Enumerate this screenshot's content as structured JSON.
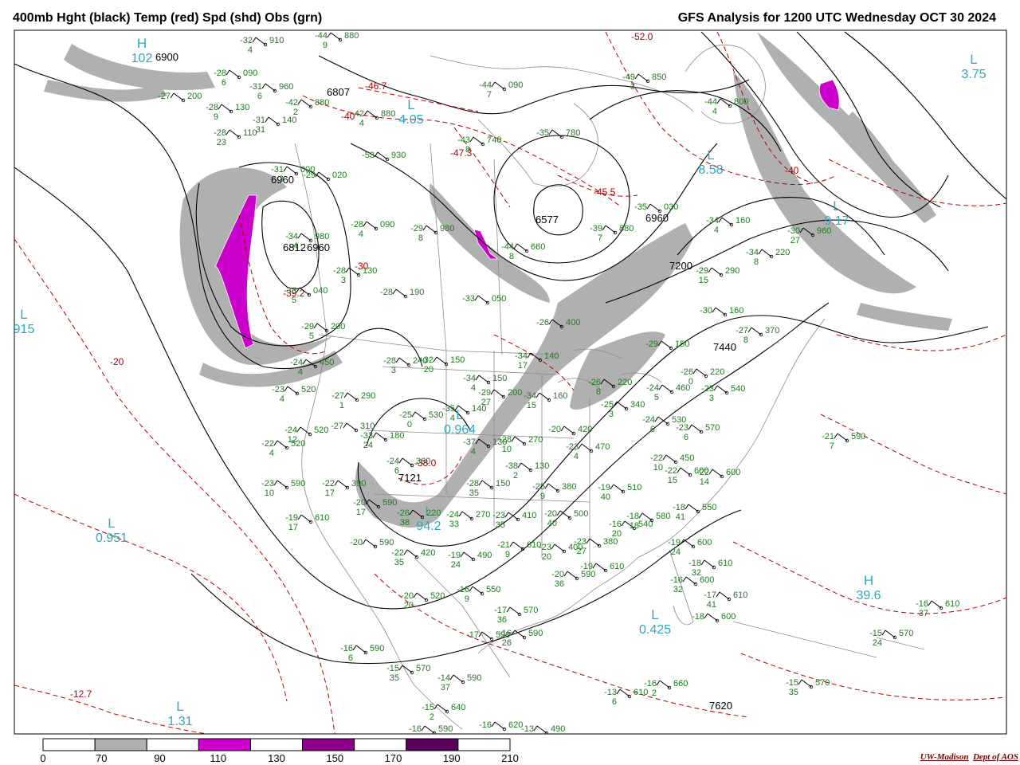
{
  "header": {
    "left_title": "400mb Hght (black) Temp (red) Spd (shd) Obs (grn)",
    "right_title": "GFS Analysis for 1200 UTC Wednesday  OCT 30 2024"
  },
  "colors": {
    "height_contour": "#000000",
    "temp_contour": "#b30000",
    "speed_70_90": "#b0b0b0",
    "speed_110_130": "#cc00cc",
    "speed_150_170": "#8c008c",
    "speed_190_210": "#5a005a",
    "obs": "#1f7a1f",
    "pressure_center": "#2aa9c0",
    "geography": "#8a8a8a"
  },
  "legend": {
    "labels": [
      "0",
      "70",
      "90",
      "110",
      "130",
      "150",
      "170",
      "190",
      "210"
    ]
  },
  "credit": {
    "org": "UW-Madison",
    "dept": "Dept of AOS"
  },
  "centers": [
    {
      "letter": "L",
      "value": "3.75"
    },
    {
      "letter": "L",
      "value": "8.58"
    },
    {
      "letter": "L",
      "value": "9.17"
    },
    {
      "letter": "L",
      "value": "0.964"
    },
    {
      "letter": "L",
      "value": "0.951"
    },
    {
      "letter": "L",
      "value": "0.425"
    },
    {
      "letter": "L",
      "value": "4.05"
    },
    {
      "letter": "L",
      "value": "1.31"
    },
    {
      "letter": "L",
      "value": "915"
    },
    {
      "letter": "L",
      "value": "94.2"
    },
    {
      "letter": "H",
      "value": "39.6"
    },
    {
      "letter": "H",
      "value": "102"
    }
  ],
  "height_labels": [
    "6807",
    "6960",
    "6812",
    "6960",
    "6577",
    "6960",
    "7121",
    "7440",
    "7620",
    "7200",
    "6900"
  ],
  "temp_labels": [
    "-46.7",
    "-40",
    "-47.3",
    "-45.5",
    "-52.0",
    "-40",
    "-30",
    "-39.2",
    "-20",
    "-12.7",
    "-38.0"
  ],
  "observations": [
    {
      "t": "-32",
      "h": "910",
      "d": "4"
    },
    {
      "t": "-44",
      "h": "880",
      "d": "9"
    },
    {
      "t": "-28",
      "h": "090",
      "d": "6"
    },
    {
      "t": "-27",
      "h": "200",
      "d": ""
    },
    {
      "t": "-31",
      "h": "960",
      "d": "6"
    },
    {
      "t": "-42",
      "h": "880",
      "d": "2"
    },
    {
      "t": "-28",
      "h": "130",
      "d": "9"
    },
    {
      "t": "-31",
      "h": "140",
      "d": "31"
    },
    {
      "t": "-28",
      "h": "110",
      "d": "23"
    },
    {
      "t": "-44",
      "h": "090",
      "d": "7"
    },
    {
      "t": "-42",
      "h": "880",
      "d": "4"
    },
    {
      "t": "-43",
      "h": "740",
      "d": "8"
    },
    {
      "t": "-53",
      "h": "930",
      "d": ""
    },
    {
      "t": "-35",
      "h": "780",
      "d": ""
    },
    {
      "t": "-49",
      "h": "850",
      "d": "3"
    },
    {
      "t": "-44",
      "h": "800",
      "d": "4"
    },
    {
      "t": "-31",
      "h": "000",
      "d": "3"
    },
    {
      "t": "-29",
      "h": "020",
      "d": ""
    },
    {
      "t": "-34",
      "h": "980",
      "d": "4"
    },
    {
      "t": "-28",
      "h": "090",
      "d": "4"
    },
    {
      "t": "-29",
      "h": "980",
      "d": "8"
    },
    {
      "t": "-44",
      "h": "660",
      "d": "8"
    },
    {
      "t": "-35",
      "h": "030",
      "d": ""
    },
    {
      "t": "-39",
      "h": "880",
      "d": "7"
    },
    {
      "t": "-34",
      "h": "160",
      "d": "4"
    },
    {
      "t": "-30",
      "h": "960",
      "d": "27"
    },
    {
      "t": "-34",
      "h": "220",
      "d": "8"
    },
    {
      "t": "-28",
      "h": "130",
      "d": "3"
    },
    {
      "t": "-33",
      "h": "040",
      "d": "5"
    },
    {
      "t": "-28",
      "h": "190",
      "d": ""
    },
    {
      "t": "-33",
      "h": "050",
      "d": ""
    },
    {
      "t": "-29",
      "h": "200",
      "d": "5"
    },
    {
      "t": "-29",
      "h": "290",
      "d": "15"
    },
    {
      "t": "-30",
      "h": "160",
      "d": ""
    },
    {
      "t": "-27",
      "h": "370",
      "d": "8"
    },
    {
      "t": "-26",
      "h": "400",
      "d": ""
    },
    {
      "t": "-29",
      "h": "150",
      "d": ""
    },
    {
      "t": "-24",
      "h": "450",
      "d": "4"
    },
    {
      "t": "-28",
      "h": "240",
      "d": "3"
    },
    {
      "t": "-32",
      "h": "150",
      "d": "20"
    },
    {
      "t": "-34",
      "h": "140",
      "d": "17"
    },
    {
      "t": "-26",
      "h": "220",
      "d": "0"
    },
    {
      "t": "-23",
      "h": "520",
      "d": "4"
    },
    {
      "t": "-27",
      "h": "290",
      "d": "1"
    },
    {
      "t": "-34",
      "h": "150",
      "d": "4"
    },
    {
      "t": "-29",
      "h": "200",
      "d": "27"
    },
    {
      "t": "-26",
      "h": "220",
      "d": "8"
    },
    {
      "t": "-24",
      "h": "460",
      "d": "5"
    },
    {
      "t": "-23",
      "h": "540",
      "d": "3"
    },
    {
      "t": "-25",
      "h": "530",
      "d": "0"
    },
    {
      "t": "-35",
      "h": "140",
      "d": "4"
    },
    {
      "t": "-34",
      "h": "160",
      "d": "15"
    },
    {
      "t": "-25",
      "h": "340",
      "d": "3"
    },
    {
      "t": "-24",
      "h": "530",
      "d": "6"
    },
    {
      "t": "-23",
      "h": "570",
      "d": "6"
    },
    {
      "t": "-21",
      "h": "590",
      "d": "7"
    },
    {
      "t": "-24",
      "h": "520",
      "d": "12"
    },
    {
      "t": "-27",
      "h": "310",
      "d": ""
    },
    {
      "t": "-33",
      "h": "180",
      "d": "24"
    },
    {
      "t": "-37",
      "h": "130",
      "d": "4"
    },
    {
      "t": "-28",
      "h": "270",
      "d": "10"
    },
    {
      "t": "-20",
      "h": "420",
      "d": ""
    },
    {
      "t": "-23",
      "h": "470",
      "d": "4"
    },
    {
      "t": "-22",
      "h": "520",
      "d": "4"
    },
    {
      "t": "-24",
      "h": "360",
      "d": "6"
    },
    {
      "t": "-38",
      "h": "130",
      "d": "2"
    },
    {
      "t": "-22",
      "h": "450",
      "d": "10"
    },
    {
      "t": "-22",
      "h": "600",
      "d": "15"
    },
    {
      "t": "-22",
      "h": "600",
      "d": "14"
    },
    {
      "t": "-23",
      "h": "590",
      "d": "10"
    },
    {
      "t": "-22",
      "h": "390",
      "d": "17"
    },
    {
      "t": "-28",
      "h": "150",
      "d": "35"
    },
    {
      "t": "-25",
      "h": "380",
      "d": "9"
    },
    {
      "t": "-19",
      "h": "510",
      "d": "40"
    },
    {
      "t": "-20",
      "h": "590",
      "d": "17"
    },
    {
      "t": "-26",
      "h": "220",
      "d": "38"
    },
    {
      "t": "-24",
      "h": "270",
      "d": "33"
    },
    {
      "t": "-23",
      "h": "410",
      "d": "35"
    },
    {
      "t": "-20",
      "h": "500",
      "d": "40"
    },
    {
      "t": "-18",
      "h": "550",
      "d": "41"
    },
    {
      "t": "-19",
      "h": "610",
      "d": "17"
    },
    {
      "t": "-20",
      "h": "590",
      "d": ""
    },
    {
      "t": "-21",
      "h": "610",
      "d": "9"
    },
    {
      "t": "-23",
      "h": "400",
      "d": "20"
    },
    {
      "t": "-23",
      "h": "380",
      "d": "27"
    },
    {
      "t": "-16",
      "h": "540",
      "d": "20"
    },
    {
      "t": "-18",
      "h": "580",
      "d": "18"
    },
    {
      "t": "-19",
      "h": "600",
      "d": "24"
    },
    {
      "t": "-18",
      "h": "610",
      "d": "32"
    },
    {
      "t": "-22",
      "h": "420",
      "d": "35"
    },
    {
      "t": "-19",
      "h": "490",
      "d": "24"
    },
    {
      "t": "-20",
      "h": "590",
      "d": "36"
    },
    {
      "t": "-19",
      "h": "610",
      "d": ""
    },
    {
      "t": "-16",
      "h": "600",
      "d": "32"
    },
    {
      "t": "-17",
      "h": "610",
      "d": "41"
    },
    {
      "t": "-20",
      "h": "520",
      "d": "20"
    },
    {
      "t": "-16",
      "h": "550",
      "d": "9"
    },
    {
      "t": "-17",
      "h": "570",
      "d": "36"
    },
    {
      "t": "-18",
      "h": "600",
      "d": ""
    },
    {
      "t": "-16",
      "h": "610",
      "d": "37"
    },
    {
      "t": "-17",
      "h": "590",
      "d": ""
    },
    {
      "t": "-16",
      "h": "590",
      "d": "26"
    },
    {
      "t": "-15",
      "h": "570",
      "d": "24"
    },
    {
      "t": "-16",
      "h": "590",
      "d": "6"
    },
    {
      "t": "-15",
      "h": "570",
      "d": "35"
    },
    {
      "t": "-14",
      "h": "590",
      "d": "37"
    },
    {
      "t": "-15",
      "h": "570",
      "d": "35"
    },
    {
      "t": "-13",
      "h": "610",
      "d": "6"
    },
    {
      "t": "-16",
      "h": "660",
      "d": "2"
    },
    {
      "t": "-15",
      "h": "640",
      "d": "2"
    },
    {
      "t": "-16",
      "h": "590",
      "d": "27"
    },
    {
      "t": "-16",
      "h": "620",
      "d": ""
    },
    {
      "t": "-13",
      "h": "490",
      "d": ""
    },
    {
      "t": "-14",
      "h": "600",
      "d": ""
    }
  ]
}
